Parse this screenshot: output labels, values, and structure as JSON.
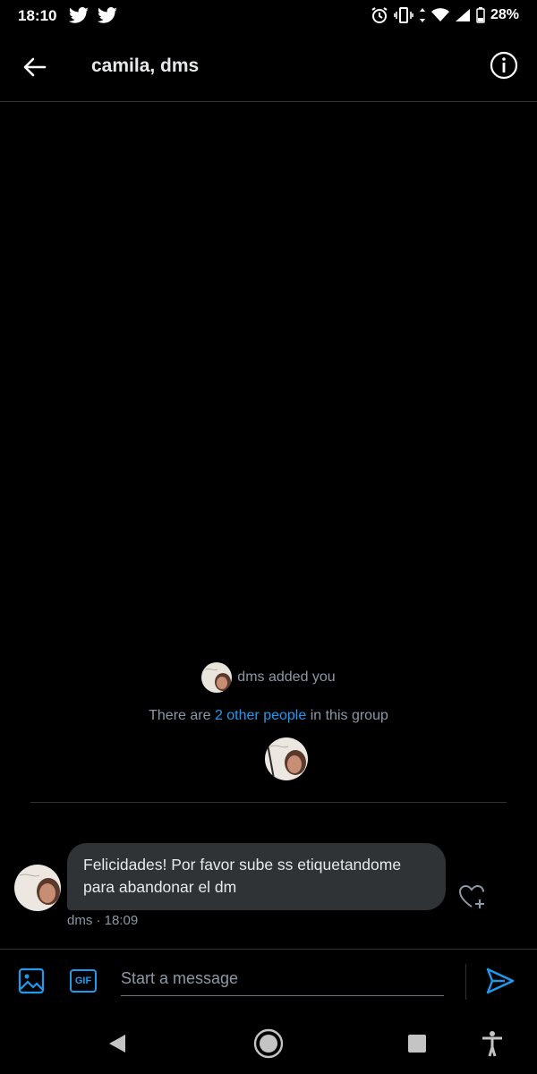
{
  "status_bar": {
    "time": "18:10",
    "battery": "28%"
  },
  "header": {
    "title": "camila, dms"
  },
  "system": {
    "added_text": "dms added you",
    "group_prefix": "There are ",
    "group_link": "2 other people",
    "group_suffix": " in this group"
  },
  "message": {
    "line1": "Felicidades! Por favor sube ss etiquetandome",
    "line2": "para abandonar el dm",
    "meta": "dms · 18:09"
  },
  "composer": {
    "placeholder": "Start a message",
    "gif_label": "GIF"
  },
  "colors": {
    "accent": "#1d9bf0",
    "bubble": "#2f3336",
    "muted": "#8b98a5"
  }
}
